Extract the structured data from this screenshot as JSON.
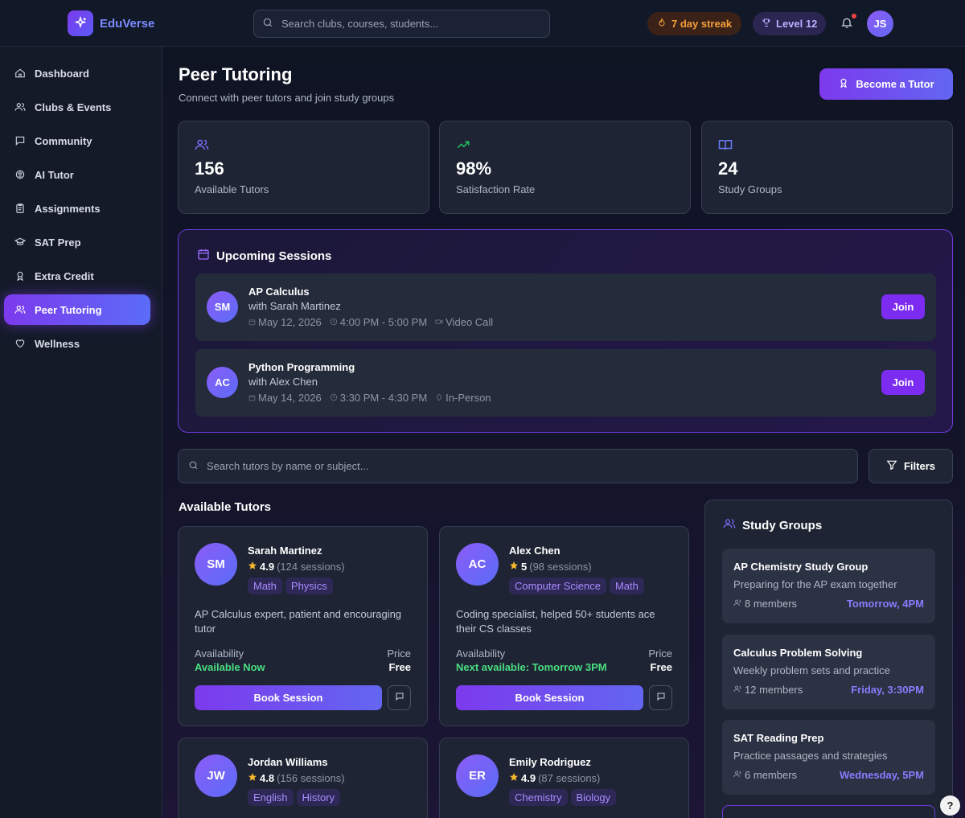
{
  "app": {
    "name": "EduVerse"
  },
  "header": {
    "search_placeholder": "Search clubs, courses, students...",
    "streak": "7 day streak",
    "level": "Level 12",
    "user_initials": "JS"
  },
  "sidebar": {
    "items": [
      {
        "label": "Dashboard",
        "icon": "home-icon"
      },
      {
        "label": "Clubs & Events",
        "icon": "users-icon"
      },
      {
        "label": "Community",
        "icon": "message-icon"
      },
      {
        "label": "AI Tutor",
        "icon": "brain-icon"
      },
      {
        "label": "Assignments",
        "icon": "clipboard-icon"
      },
      {
        "label": "SAT Prep",
        "icon": "graduation-cap-icon"
      },
      {
        "label": "Extra Credit",
        "icon": "award-icon"
      },
      {
        "label": "Peer Tutoring",
        "icon": "users-icon",
        "active": true
      },
      {
        "label": "Wellness",
        "icon": "heart-icon"
      }
    ]
  },
  "page": {
    "title": "Peer Tutoring",
    "subtitle": "Connect with peer tutors and join study groups",
    "become_tutor": "Become a Tutor"
  },
  "stats": [
    {
      "value": "156",
      "label": "Available Tutors",
      "icon": "users-icon",
      "color": "#7c6cf8"
    },
    {
      "value": "98%",
      "label": "Satisfaction Rate",
      "icon": "trending-up-icon",
      "color": "#22c55e"
    },
    {
      "value": "24",
      "label": "Study Groups",
      "icon": "book-open-icon",
      "color": "#6b7cf8"
    }
  ],
  "upcoming": {
    "title": "Upcoming Sessions",
    "join_label": "Join",
    "sessions": [
      {
        "initials": "SM",
        "title": "AP Calculus",
        "with": "with Sarah Martinez",
        "date": "May 12, 2026",
        "time": "4:00 PM - 5:00 PM",
        "mode": "Video Call"
      },
      {
        "initials": "AC",
        "title": "Python Programming",
        "with": "with Alex Chen",
        "date": "May 14, 2026",
        "time": "3:30 PM - 4:30 PM",
        "mode": "In-Person"
      }
    ]
  },
  "tutor_search": {
    "placeholder": "Search tutors by name or subject...",
    "filters": "Filters"
  },
  "tutors_section": {
    "title": "Available Tutors",
    "availability_label": "Availability",
    "price_label": "Price",
    "book_label": "Book Session",
    "tutors": [
      {
        "initials": "SM",
        "name": "Sarah Martinez",
        "rating": "4.9",
        "sessions": "(124 sessions)",
        "tags": [
          "Math",
          "Physics"
        ],
        "desc": "AP Calculus expert, patient and encouraging tutor",
        "availability": "Available Now",
        "price": "Free"
      },
      {
        "initials": "AC",
        "name": "Alex Chen",
        "rating": "5",
        "sessions": "(98 sessions)",
        "tags": [
          "Computer Science",
          "Math"
        ],
        "desc": "Coding specialist, helped 50+ students ace their CS classes",
        "availability": "Next available: Tomorrow 3PM",
        "price": "Free"
      },
      {
        "initials": "JW",
        "name": "Jordan Williams",
        "rating": "4.8",
        "sessions": "(156 sessions)",
        "tags": [
          "English",
          "History"
        ]
      },
      {
        "initials": "ER",
        "name": "Emily Rodriguez",
        "rating": "4.9",
        "sessions": "(87 sessions)",
        "tags": [
          "Chemistry",
          "Biology"
        ]
      }
    ]
  },
  "study_groups": {
    "title": "Study Groups",
    "groups": [
      {
        "name": "AP Chemistry Study Group",
        "desc": "Preparing for the AP exam together",
        "members": "8 members",
        "time": "Tomorrow, 4PM"
      },
      {
        "name": "Calculus Problem Solving",
        "desc": "Weekly problem sets and practice",
        "members": "12 members",
        "time": "Friday, 3:30PM"
      },
      {
        "name": "SAT Reading Prep",
        "desc": "Practice passages and strategies",
        "members": "6 members",
        "time": "Wednesday, 5PM"
      }
    ]
  },
  "help_label": "?"
}
